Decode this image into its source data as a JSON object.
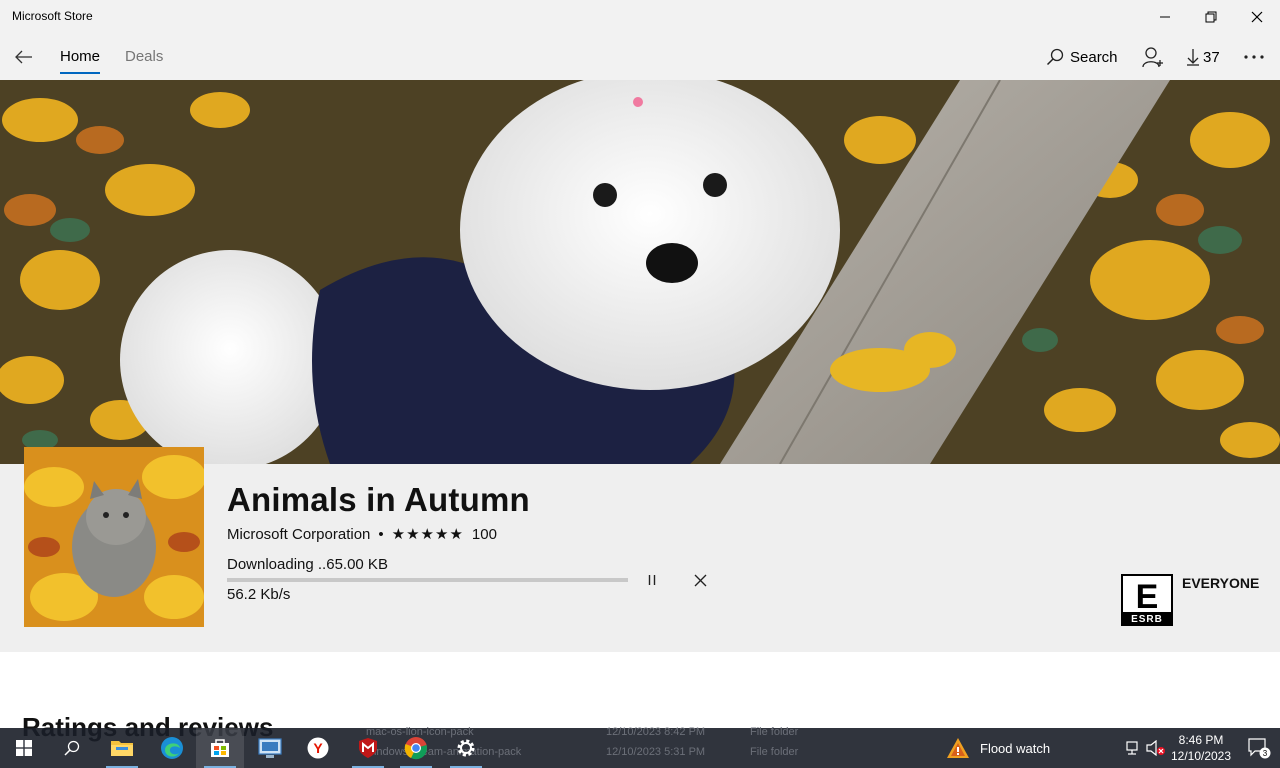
{
  "window": {
    "title": "Microsoft Store"
  },
  "nav": {
    "tabs": [
      {
        "label": "Home"
      },
      {
        "label": "Deals"
      }
    ],
    "search_label": "Search",
    "downloads_count": "37"
  },
  "app": {
    "name": "Animals in Autumn",
    "publisher": "Microsoft Corporation",
    "separator": "•",
    "stars_text": "★★★★★",
    "rating_count": "100",
    "download_status": "Downloading ..65.00 KB",
    "download_progress": 0.0,
    "download_speed": "56.2 Kb/s",
    "age_rating": "EVERYONE",
    "esrb_letter": "E",
    "esrb_caption": "ESRB"
  },
  "page": {
    "ratings_heading": "Ratings and reviews"
  },
  "background_file_list": {
    "rows": [
      {
        "name": "mac-os-lion-icon-pack",
        "date": "12/10/2023 8:42 PM",
        "type": "File folder"
      },
      {
        "name": "windows-dream-animation-pack",
        "date": "12/10/2023 5:31 PM",
        "type": "File folder"
      }
    ]
  },
  "taskbar": {
    "weather_text": "Flood watch",
    "time": "8:46 PM",
    "date": "12/10/2023",
    "notification_count": "3",
    "apps": [
      "start-icon",
      "search-icon",
      "file-explorer-icon",
      "edge-icon",
      "store-icon",
      "remote-desktop-icon",
      "yandex-icon",
      "mcafee-icon",
      "chrome-icon",
      "settings-icon"
    ]
  },
  "colors": {
    "accent": "#0067c0",
    "titlebar_bg": "#f2f2f2",
    "taskbar_bg": "#191e28"
  }
}
